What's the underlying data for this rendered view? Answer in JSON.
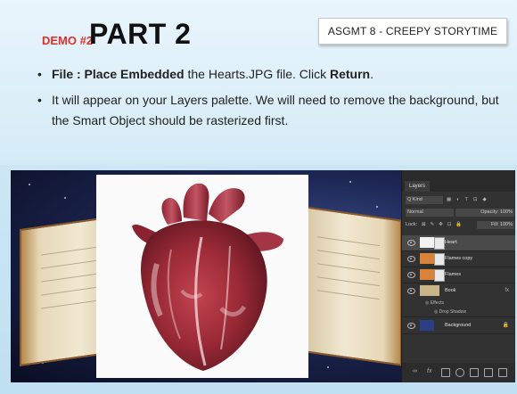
{
  "slide": {
    "demo_label": "DEMO #2",
    "title": "PART 2",
    "badge": "ASGMT 8 - CREEPY STORYTIME",
    "bullet1": {
      "b1": "File : Place Embedded",
      "t1": " the Hearts.JPG file. Click ",
      "b2": "Return",
      "t2": "."
    },
    "bullet2": "It will appear on your Layers palette. We will need to remove the background, but the Smart Object should be rasterized first."
  },
  "layers_panel": {
    "tab": "Layers",
    "kind": "Q Kind",
    "blend_mode": "Normal",
    "opacity": "Opacity: 100%",
    "lock": "Lock:",
    "fill": "Fill: 100%",
    "layers": [
      {
        "name": "Heart",
        "selected": true
      },
      {
        "name": "Flames copy",
        "selected": false
      },
      {
        "name": "Flames",
        "selected": false
      },
      {
        "name": "Book",
        "selected": false,
        "fx": "fx"
      },
      {
        "name": "Background",
        "selected": false
      }
    ],
    "effects": "Effects",
    "drop_shadow": "Drop Shadow"
  },
  "colors": {
    "accent_red": "#e0302a",
    "panel_bg": "#323232",
    "slide_bg": "#cde6f5"
  }
}
